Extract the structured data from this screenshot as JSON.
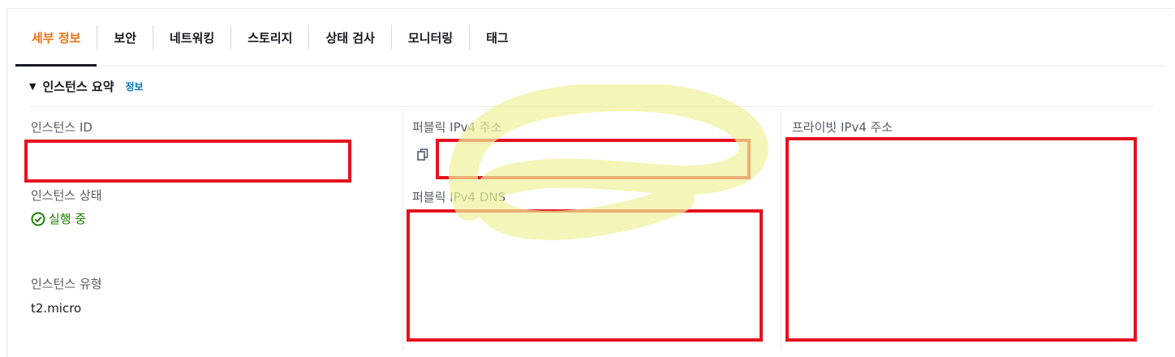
{
  "tabs": [
    {
      "label": "세부 정보",
      "active": true
    },
    {
      "label": "보안"
    },
    {
      "label": "네트워킹"
    },
    {
      "label": "스토리지"
    },
    {
      "label": "상태 검사"
    },
    {
      "label": "모니터링"
    },
    {
      "label": "태그"
    }
  ],
  "summary": {
    "title": "인스턴스 요약",
    "info_link": "정보",
    "caret_icon": "caret-down-icon"
  },
  "fields": {
    "instance_id": {
      "label": "인스턴스 ID",
      "value": ""
    },
    "instance_state": {
      "label": "인스턴스 상태",
      "value": "실행 중",
      "icon": "check-circle-icon",
      "color": "#1d8102"
    },
    "instance_type": {
      "label": "인스턴스 유형",
      "value": "t2.micro"
    },
    "public_ipv4": {
      "label": "퍼블릭 IPv4 주소",
      "value": "",
      "icon": "copy-icon"
    },
    "public_dns": {
      "label": "퍼블릭 IPv4 DNS",
      "value": ""
    },
    "private_ipv4": {
      "label": "프라이빗 IPv4 주소",
      "value": ""
    }
  },
  "colors": {
    "active_tab": "#ec7211",
    "link": "#0073bb",
    "redaction_box": "#e5121f",
    "highlighter": "#eef29a"
  }
}
